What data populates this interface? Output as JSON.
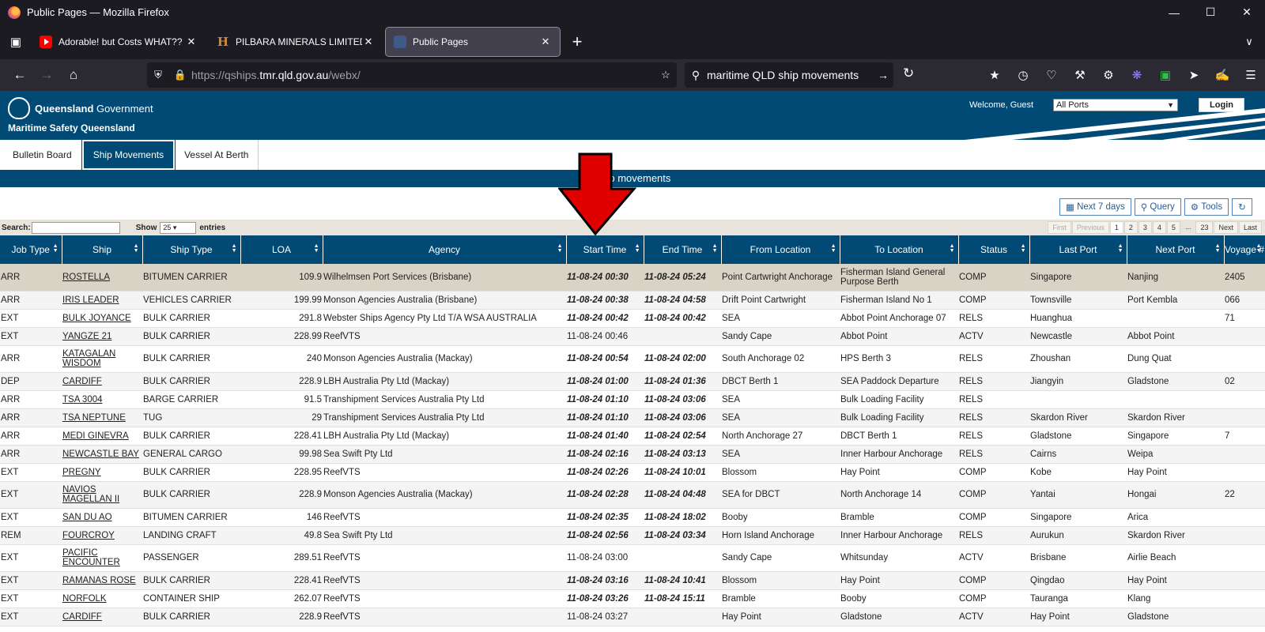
{
  "browser": {
    "window_title": "Public Pages — Mozilla Firefox",
    "tabs": [
      {
        "label": "Adorable! but Costs WHAT?? //",
        "icon": "youtube-icon"
      },
      {
        "label": "PILBARA MINERALS LIMITED (A",
        "icon": "h-favicon-icon"
      },
      {
        "label": "Public Pages",
        "icon": "qld-favicon-icon",
        "active": true
      }
    ],
    "url_prefix": "https://qships.",
    "url_domain": "tmr.qld.gov.au",
    "url_path": "/webx/",
    "search_text": "maritime QLD ship movements"
  },
  "site": {
    "gov_bold": "Queensland",
    "gov_rest": " Government",
    "org": "Maritime Safety Queensland",
    "welcome": "Welcome, Guest",
    "port_select": "All Ports",
    "login": "Login",
    "menu": [
      "Bulletin Board",
      "Ship Movements",
      "Vessel At Berth"
    ],
    "section_title": "Ship movements",
    "buttons": {
      "next7": "Next 7 days",
      "query": "Query",
      "tools": "Tools"
    },
    "search_label": "Search:",
    "show_label": "Show",
    "entries_value": "25",
    "entries_label": "entries",
    "pager": [
      "First",
      "Previous",
      "1",
      "2",
      "3",
      "4",
      "5",
      "...",
      "23",
      "Next",
      "Last"
    ]
  },
  "table": {
    "columns": [
      "Job Type",
      "Ship",
      "Ship Type",
      "LOA",
      "Agency",
      "Start Time",
      "End Time",
      "From Location",
      "To Location",
      "Status",
      "Last Port",
      "Next Port",
      "Voyage #"
    ],
    "rows": [
      [
        "ARR",
        "ROSTELLA",
        "BITUMEN CARRIER",
        "109.9",
        "Wilhelmsen Port Services (Brisbane)",
        "11-08-24 00:30",
        "11-08-24 05:24",
        "Point Cartwright Anchorage",
        "Fisherman Island General Purpose Berth",
        "COMP",
        "Singapore",
        "Nanjing",
        "2405"
      ],
      [
        "ARR",
        "IRIS LEADER",
        "VEHICLES CARRIER",
        "199.99",
        "Monson Agencies Australia (Brisbane)",
        "11-08-24 00:38",
        "11-08-24 04:58",
        "Drift Point Cartwright",
        "Fisherman Island No 1",
        "COMP",
        "Townsville",
        "Port Kembla",
        "066"
      ],
      [
        "EXT",
        "BULK JOYANCE",
        "BULK CARRIER",
        "291.8",
        "Webster Ships Agency Pty Ltd T/A WSA AUSTRALIA",
        "11-08-24 00:42",
        "11-08-24 00:42",
        "SEA",
        "Abbot Point Anchorage 07",
        "RELS",
        "Huanghua",
        "",
        "71"
      ],
      [
        "EXT",
        "YANGZE 21",
        "BULK CARRIER",
        "228.99",
        "ReefVTS",
        "11-08-24 00:46",
        "",
        "Sandy Cape",
        "Abbot Point",
        "ACTV",
        "Newcastle",
        "Abbot Point",
        ""
      ],
      [
        "ARR",
        "KATAGALAN WISDOM",
        "BULK CARRIER",
        "240",
        "Monson Agencies Australia (Mackay)",
        "11-08-24 00:54",
        "11-08-24 02:00",
        "South Anchorage 02",
        "HPS Berth 3",
        "RELS",
        "Zhoushan",
        "Dung Quat",
        ""
      ],
      [
        "DEP",
        "CARDIFF",
        "BULK CARRIER",
        "228.9",
        "LBH Australia Pty Ltd (Mackay)",
        "11-08-24 01:00",
        "11-08-24 01:36",
        "DBCT Berth 1",
        "SEA Paddock Departure",
        "RELS",
        "Jiangyin",
        "Gladstone",
        "02"
      ],
      [
        "ARR",
        "TSA 3004",
        "BARGE CARRIER",
        "91.5",
        "Transhipment Services Australia Pty Ltd",
        "11-08-24 01:10",
        "11-08-24 03:06",
        "SEA",
        "Bulk Loading Facility",
        "RELS",
        "",
        "",
        ""
      ],
      [
        "ARR",
        "TSA NEPTUNE",
        "TUG",
        "29",
        "Transhipment Services Australia Pty Ltd",
        "11-08-24 01:10",
        "11-08-24 03:06",
        "SEA",
        "Bulk Loading Facility",
        "RELS",
        "Skardon River",
        "Skardon River",
        ""
      ],
      [
        "ARR",
        "MEDI GINEVRA",
        "BULK CARRIER",
        "228.41",
        "LBH Australia Pty Ltd (Mackay)",
        "11-08-24 01:40",
        "11-08-24 02:54",
        "North Anchorage 27",
        "DBCT Berth 1",
        "RELS",
        "Gladstone",
        "Singapore",
        "7"
      ],
      [
        "ARR",
        "NEWCASTLE BAY",
        "GENERAL CARGO",
        "99.98",
        "Sea Swift Pty Ltd",
        "11-08-24 02:16",
        "11-08-24 03:13",
        "SEA",
        "Inner Harbour Anchorage",
        "RELS",
        "Cairns",
        "Weipa",
        ""
      ],
      [
        "EXT",
        "PREGNY",
        "BULK CARRIER",
        "228.95",
        "ReefVTS",
        "11-08-24 02:26",
        "11-08-24 10:01",
        "Blossom",
        "Hay Point",
        "COMP",
        "Kobe",
        "Hay Point",
        ""
      ],
      [
        "EXT",
        "NAVIOS MAGELLAN II",
        "BULK CARRIER",
        "228.9",
        "Monson Agencies Australia (Mackay)",
        "11-08-24 02:28",
        "11-08-24 04:48",
        "SEA for DBCT",
        "North Anchorage 14",
        "COMP",
        "Yantai",
        "Hongai",
        "22"
      ],
      [
        "EXT",
        "SAN DU AO",
        "BITUMEN CARRIER",
        "146",
        "ReefVTS",
        "11-08-24 02:35",
        "11-08-24 18:02",
        "Booby",
        "Bramble",
        "COMP",
        "Singapore",
        "Arica",
        ""
      ],
      [
        "REM",
        "FOURCROY",
        "LANDING CRAFT",
        "49.8",
        "Sea Swift Pty Ltd",
        "11-08-24 02:56",
        "11-08-24 03:34",
        "Horn Island Anchorage",
        "Inner Harbour Anchorage",
        "RELS",
        "Aurukun",
        "Skardon River",
        ""
      ],
      [
        "EXT",
        "PACIFIC ENCOUNTER",
        "PASSENGER",
        "289.51",
        "ReefVTS",
        "11-08-24 03:00",
        "",
        "Sandy Cape",
        "Whitsunday",
        "ACTV",
        "Brisbane",
        "Airlie Beach",
        ""
      ],
      [
        "EXT",
        "RAMANAS ROSE",
        "BULK CARRIER",
        "228.41",
        "ReefVTS",
        "11-08-24 03:16",
        "11-08-24 10:41",
        "Blossom",
        "Hay Point",
        "COMP",
        "Qingdao",
        "Hay Point",
        ""
      ],
      [
        "EXT",
        "NORFOLK",
        "CONTAINER SHIP",
        "262.07",
        "ReefVTS",
        "11-08-24 03:26",
        "11-08-24 15:11",
        "Bramble",
        "Booby",
        "COMP",
        "Tauranga",
        "Klang",
        ""
      ],
      [
        "EXT",
        "CARDIFF",
        "BULK CARRIER",
        "228.9",
        "ReefVTS",
        "11-08-24 03:27",
        "",
        "Hay Point",
        "Gladstone",
        "ACTV",
        "Hay Point",
        "Gladstone",
        ""
      ]
    ]
  },
  "colors": {
    "brand": "#004a75",
    "arrow": "#e00000",
    "selected_row": "#d9d3c6"
  }
}
